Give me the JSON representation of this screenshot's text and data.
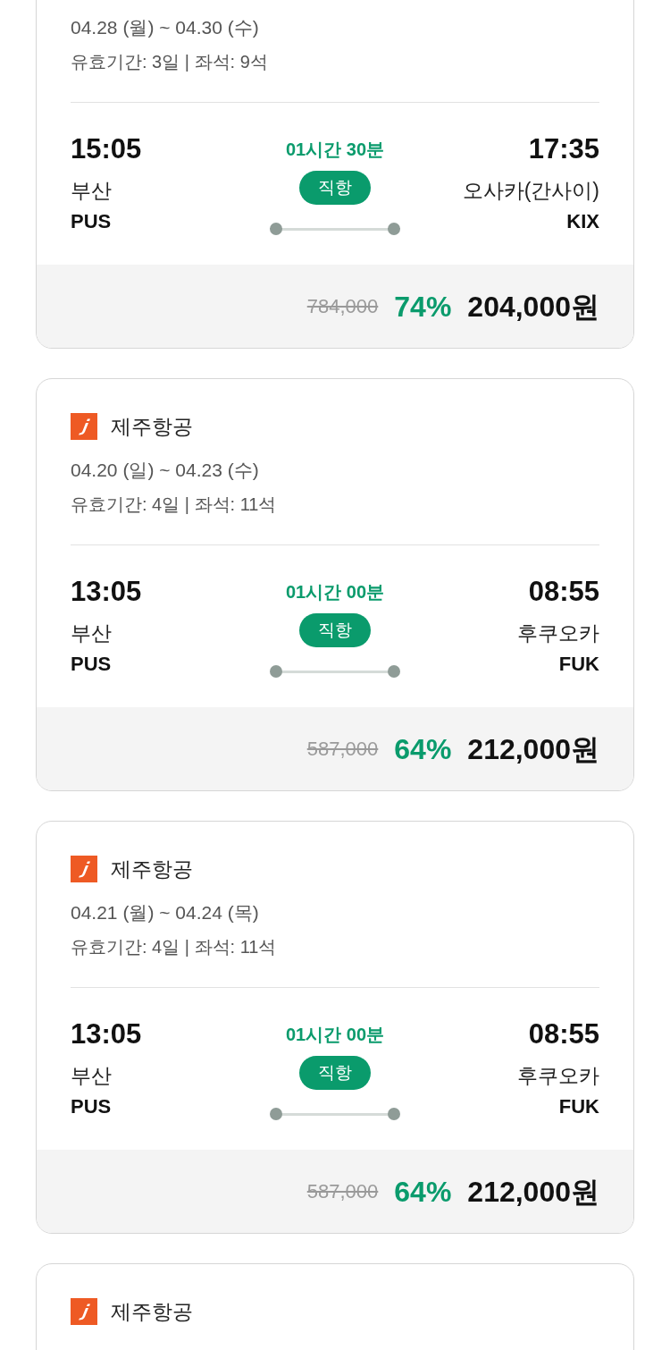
{
  "flights": [
    {
      "dates": "04.28 (월) ~ 04.30 (수)",
      "validity": "유효기간: 3일 | 좌석: 9석",
      "departure": {
        "time": "15:05",
        "city": "부산",
        "code": "PUS"
      },
      "duration": "01시간 30분",
      "route_type": "직항",
      "arrival": {
        "time": "17:35",
        "city": "오사카(간사이)",
        "code": "KIX"
      },
      "original_price": "784,000",
      "discount": "74%",
      "price": "204,000원"
    },
    {
      "airline": "제주항공",
      "dates": "04.20 (일) ~ 04.23 (수)",
      "validity": "유효기간: 4일 | 좌석: 11석",
      "departure": {
        "time": "13:05",
        "city": "부산",
        "code": "PUS"
      },
      "duration": "01시간 00분",
      "route_type": "직항",
      "arrival": {
        "time": "08:55",
        "city": "후쿠오카",
        "code": "FUK"
      },
      "original_price": "587,000",
      "discount": "64%",
      "price": "212,000원"
    },
    {
      "airline": "제주항공",
      "dates": "04.21 (월) ~ 04.24 (목)",
      "validity": "유효기간: 4일 | 좌석: 11석",
      "departure": {
        "time": "13:05",
        "city": "부산",
        "code": "PUS"
      },
      "duration": "01시간 00분",
      "route_type": "직항",
      "arrival": {
        "time": "08:55",
        "city": "후쿠오카",
        "code": "FUK"
      },
      "original_price": "587,000",
      "discount": "64%",
      "price": "212,000원"
    },
    {
      "airline": "제주항공"
    }
  ]
}
